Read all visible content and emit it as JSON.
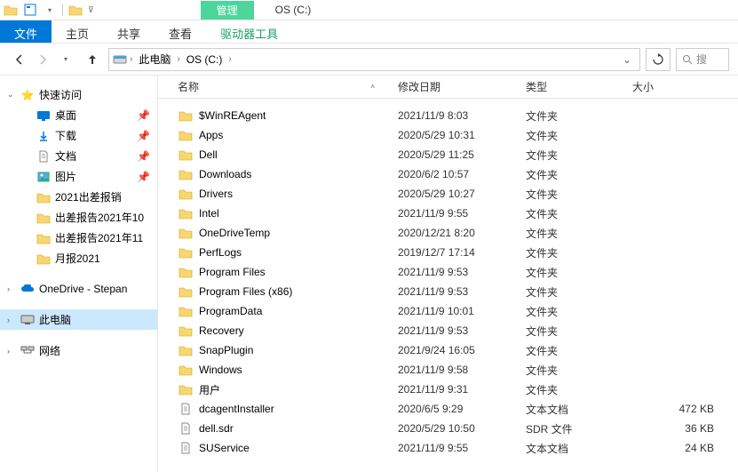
{
  "window_title": "OS (C:)",
  "manage_label": "管理",
  "ribbon": {
    "file": "文件",
    "home": "主页",
    "share": "共享",
    "view": "查看",
    "drive_tools": "驱动器工具"
  },
  "breadcrumb": [
    {
      "label": "此电脑"
    },
    {
      "label": "OS (C:)"
    }
  ],
  "search_placeholder": "搜",
  "columns": {
    "name": "名称",
    "modified": "修改日期",
    "type": "类型",
    "size": "大小"
  },
  "sidebar": {
    "quick_access": "快速访问",
    "desktop": "桌面",
    "downloads": "下载",
    "documents": "文档",
    "pictures": "图片",
    "folders": [
      "2021出差报销",
      "出差报告2021年10",
      "出差报告2021年11",
      "月报2021"
    ],
    "onedrive": "OneDrive - Stepan",
    "this_pc": "此电脑",
    "network": "网络"
  },
  "rows": [
    {
      "name": "$WinREAgent",
      "date": "2021/11/9 8:03",
      "type": "文件夹",
      "size": "",
      "icon": "folder"
    },
    {
      "name": "Apps",
      "date": "2020/5/29 10:31",
      "type": "文件夹",
      "size": "",
      "icon": "folder"
    },
    {
      "name": "Dell",
      "date": "2020/5/29 11:25",
      "type": "文件夹",
      "size": "",
      "icon": "folder"
    },
    {
      "name": "Downloads",
      "date": "2020/6/2 10:57",
      "type": "文件夹",
      "size": "",
      "icon": "folder"
    },
    {
      "name": "Drivers",
      "date": "2020/5/29 10:27",
      "type": "文件夹",
      "size": "",
      "icon": "folder"
    },
    {
      "name": "Intel",
      "date": "2021/11/9 9:55",
      "type": "文件夹",
      "size": "",
      "icon": "folder"
    },
    {
      "name": "OneDriveTemp",
      "date": "2020/12/21 8:20",
      "type": "文件夹",
      "size": "",
      "icon": "folder"
    },
    {
      "name": "PerfLogs",
      "date": "2019/12/7 17:14",
      "type": "文件夹",
      "size": "",
      "icon": "folder"
    },
    {
      "name": "Program Files",
      "date": "2021/11/9 9:53",
      "type": "文件夹",
      "size": "",
      "icon": "folder"
    },
    {
      "name": "Program Files (x86)",
      "date": "2021/11/9 9:53",
      "type": "文件夹",
      "size": "",
      "icon": "folder"
    },
    {
      "name": "ProgramData",
      "date": "2021/11/9 10:01",
      "type": "文件夹",
      "size": "",
      "icon": "folder"
    },
    {
      "name": "Recovery",
      "date": "2021/11/9 9:53",
      "type": "文件夹",
      "size": "",
      "icon": "folder"
    },
    {
      "name": "SnapPlugin",
      "date": "2021/9/24 16:05",
      "type": "文件夹",
      "size": "",
      "icon": "folder"
    },
    {
      "name": "Windows",
      "date": "2021/11/9 9:58",
      "type": "文件夹",
      "size": "",
      "icon": "folder"
    },
    {
      "name": "用户",
      "date": "2021/11/9 9:31",
      "type": "文件夹",
      "size": "",
      "icon": "folder"
    },
    {
      "name": "dcagentInstaller",
      "date": "2020/6/5 9:29",
      "type": "文本文档",
      "size": "472 KB",
      "icon": "file"
    },
    {
      "name": "dell.sdr",
      "date": "2020/5/29 10:50",
      "type": "SDR 文件",
      "size": "36 KB",
      "icon": "file"
    },
    {
      "name": "SUService",
      "date": "2021/11/9 9:55",
      "type": "文本文档",
      "size": "24 KB",
      "icon": "file"
    }
  ]
}
